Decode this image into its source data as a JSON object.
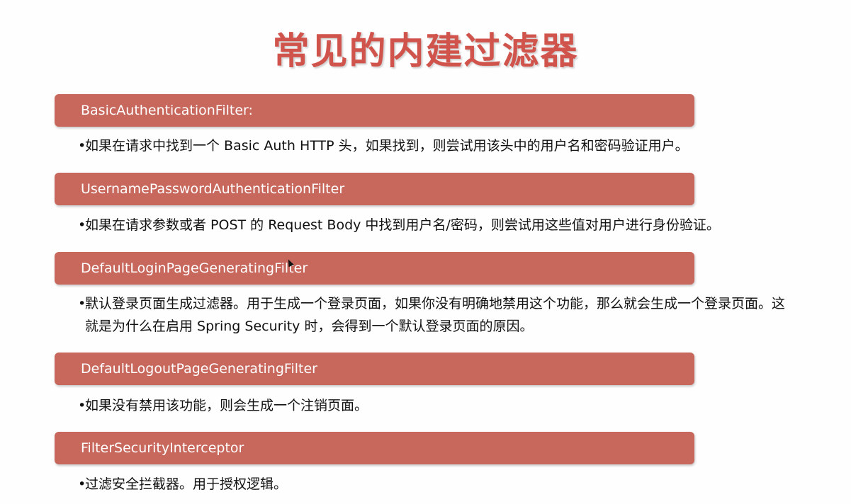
{
  "slide": {
    "title": "常见的内建过滤器",
    "accent_color": "#c8675c",
    "title_color": "#d0544c",
    "items": [
      {
        "name": "BasicAuthenticationFilter:",
        "desc_line1": "如果在请求中找到一个 Basic Auth HTTP 头，如果找到，则尝试用该头中的用户名和密码验证用户。",
        "desc_line2": ""
      },
      {
        "name": "UsernamePasswordAuthenticationFilter",
        "desc_line1": "如果在请求参数或者 POST 的 Request Body 中找到用户名/密码，则尝试用这些值对用户进行身份验证。",
        "desc_line2": ""
      },
      {
        "name": "DefaultLoginPageGeneratingFilter",
        "desc_line1": "默认登录页面生成过滤器。用于生成一个登录页面，如果你没有明确地禁用这个功能，那么就会生成一个登录页面。这",
        "desc_line2": "就是为什么在启用 Spring Security 时，会得到一个默认登录页面的原因。"
      },
      {
        "name": "DefaultLogoutPageGeneratingFilter",
        "desc_line1": "如果没有禁用该功能，则会生成一个注销页面。",
        "desc_line2": ""
      },
      {
        "name": "FilterSecurityInterceptor",
        "desc_line1": "过滤安全拦截器。用于授权逻辑。",
        "desc_line2": ""
      }
    ]
  }
}
